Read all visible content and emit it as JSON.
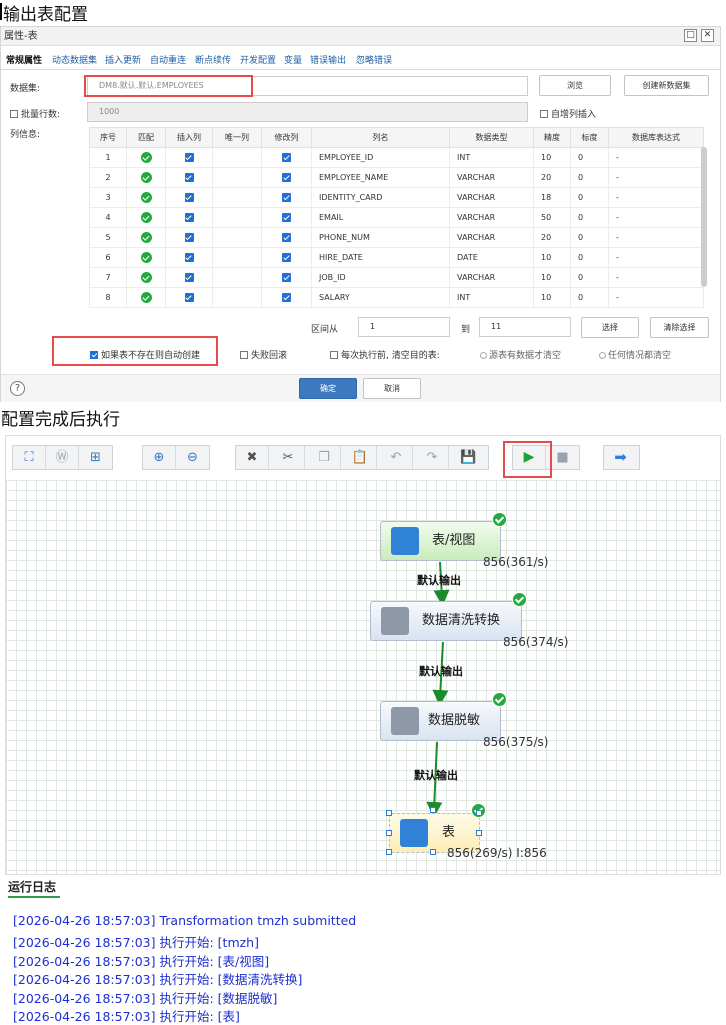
{
  "heading_top": "输出表配置",
  "dialog": {
    "title": "属性-表",
    "tabs": [
      "常规属性",
      "动态数据集",
      "插入更新",
      "自动重连",
      "断点续传",
      "开发配置",
      "变量",
      "错误输出",
      "忽略错误"
    ],
    "dataset_label": "数据集:",
    "dataset_value": "DM8.默认.默认.EMPLOYEES",
    "browse_btn": "浏览",
    "create_dataset_btn": "创建新数据集",
    "batch_label": "批量行数:",
    "batch_value": "1000",
    "auto_inc_label": "自增列插入",
    "colinfo_label": "列信息:",
    "headers": [
      "序号",
      "匹配",
      "插入列",
      "唯一列",
      "修改列",
      "列名",
      "数据类型",
      "精度",
      "标度",
      "数据库表达式"
    ],
    "rows": [
      {
        "n": "1",
        "name": "EMPLOYEE_ID",
        "type": "INT",
        "prec": "10",
        "scale": "0",
        "expr": "-"
      },
      {
        "n": "2",
        "name": "EMPLOYEE_NAME",
        "type": "VARCHAR",
        "prec": "20",
        "scale": "0",
        "expr": "-"
      },
      {
        "n": "3",
        "name": "IDENTITY_CARD",
        "type": "VARCHAR",
        "prec": "18",
        "scale": "0",
        "expr": "-"
      },
      {
        "n": "4",
        "name": "EMAIL",
        "type": "VARCHAR",
        "prec": "50",
        "scale": "0",
        "expr": "-"
      },
      {
        "n": "5",
        "name": "PHONE_NUM",
        "type": "VARCHAR",
        "prec": "20",
        "scale": "0",
        "expr": "-"
      },
      {
        "n": "6",
        "name": "HIRE_DATE",
        "type": "DATE",
        "prec": "10",
        "scale": "0",
        "expr": "-"
      },
      {
        "n": "7",
        "name": "JOB_ID",
        "type": "VARCHAR",
        "prec": "10",
        "scale": "0",
        "expr": "-"
      },
      {
        "n": "8",
        "name": "SALARY",
        "type": "INT",
        "prec": "10",
        "scale": "0",
        "expr": "-"
      }
    ],
    "range_label": "区间从",
    "range_from": "1",
    "range_to_label": "到",
    "range_to": "11",
    "select_btn": "选择",
    "clear_btn": "清除选择",
    "auto_create_label": "如果表不存在则自动创建",
    "rollback_label": "失败回滚",
    "clear_before_label": "每次执行前, 清空目的表:",
    "opt_source_label": "源表有数据才清空",
    "opt_any_label": "任何情况都清空",
    "help_icon": "?",
    "ok_btn": "确定",
    "cancel_btn": "取消"
  },
  "heading_mid": "配置完成后执行",
  "flow": {
    "nodes": [
      {
        "label": "表/视图",
        "stat": "856(361/s)"
      },
      {
        "label": "数据清洗转换",
        "stat": "856(374/s)"
      },
      {
        "label": "数据脱敏",
        "stat": "856(375/s)"
      },
      {
        "label": "表",
        "stat": "856(269/s) I:856"
      }
    ],
    "edge_label": "默认输出"
  },
  "log": {
    "title": "运行日志",
    "lines": [
      "[2026-04-26 18:57:03] Transformation tmzh submitted",
      "[2026-04-26 18:57:03] 执行开始: [tmzh]",
      "[2026-04-26 18:57:03] 执行开始: [表/视图]",
      "[2026-04-26 18:57:03] 执行开始: [数据清洗转换]",
      "[2026-04-26 18:57:03] 执行开始: [数据脱敏]",
      "[2026-04-26 18:57:03] 执行开始: [表]"
    ]
  }
}
